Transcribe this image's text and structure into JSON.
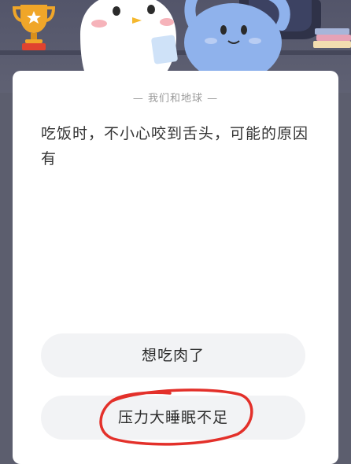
{
  "quiz": {
    "category": "— 我们和地球 —",
    "question": "吃饭时，不小心咬到舌头，可能的原因有",
    "options": [
      {
        "label": "想吃肉了"
      },
      {
        "label": "压力大睡眠不足"
      }
    ]
  },
  "colors": {
    "banner": "#5c5e6e",
    "card": "#ffffff",
    "option_bg": "#f2f3f5",
    "annotation": "#e3302a",
    "bunny": "#8fb2ec"
  },
  "icons": {
    "trophy": "trophy-icon",
    "books": "books-icon"
  }
}
